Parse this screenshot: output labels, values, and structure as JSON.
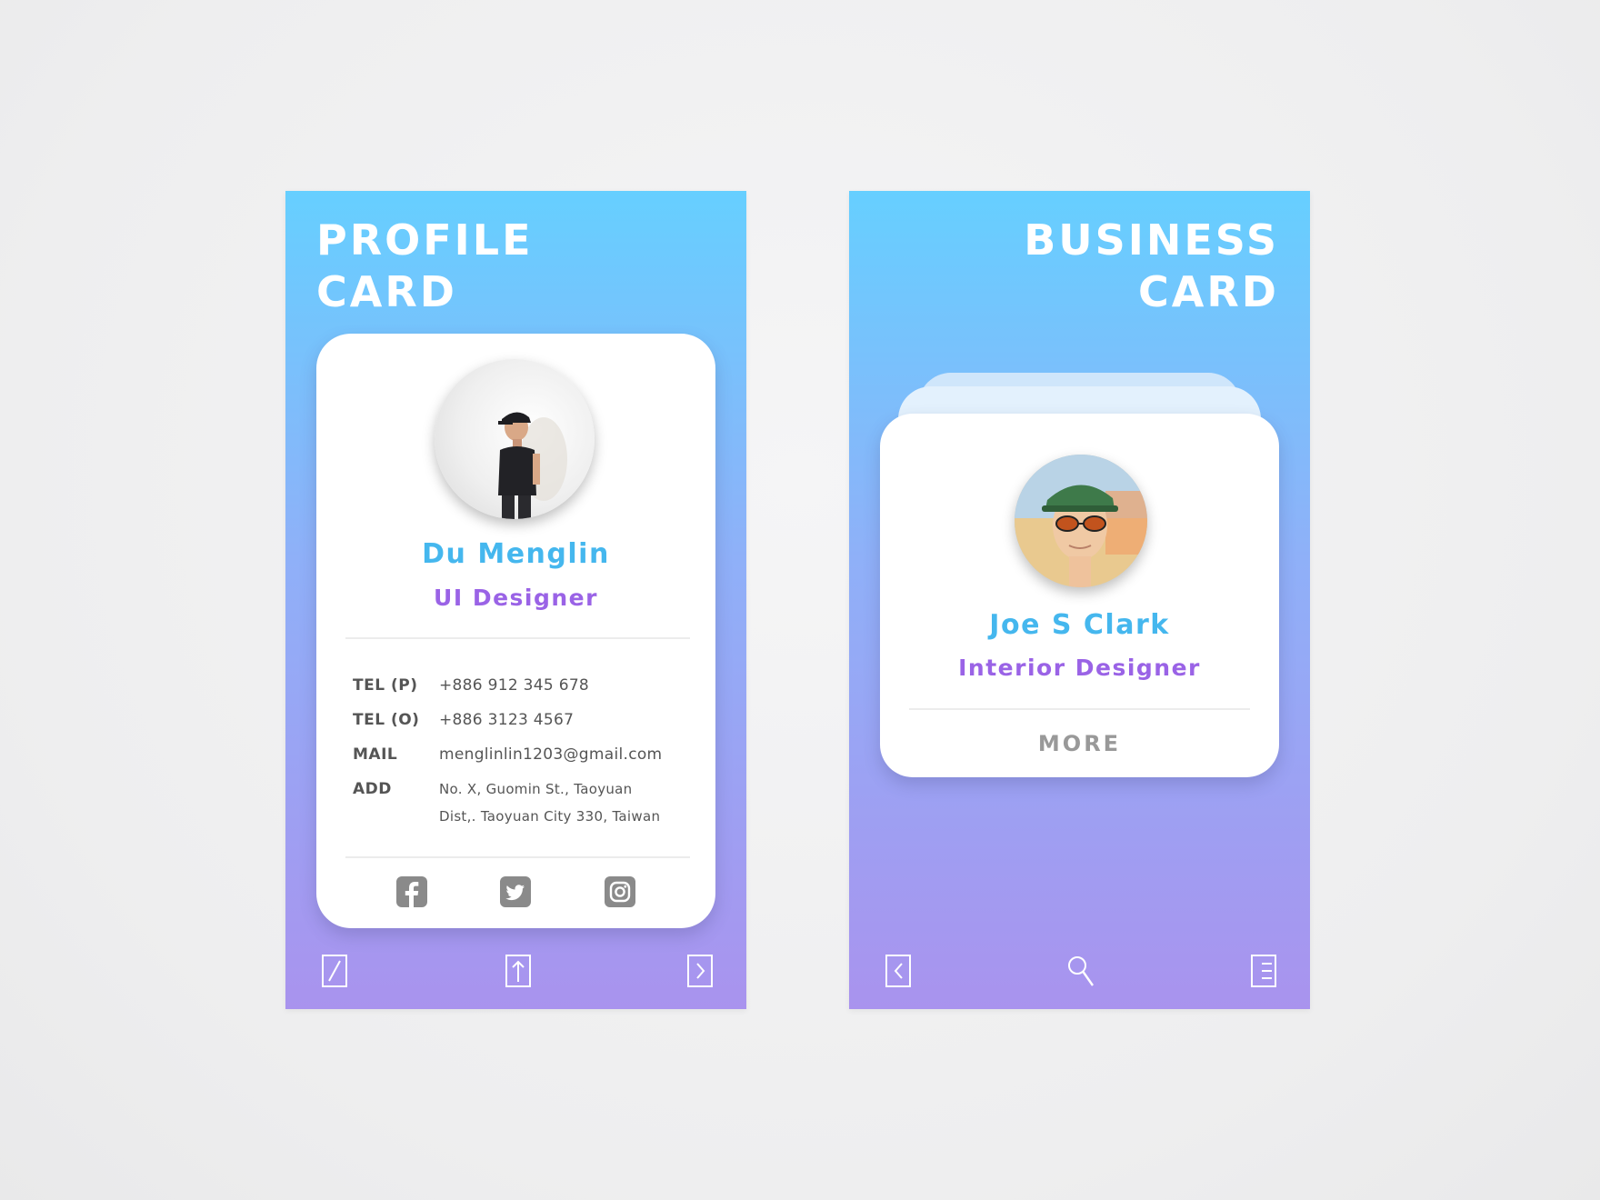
{
  "profile_panel": {
    "title_line1": "PROFILE",
    "title_line2": "CARD",
    "card": {
      "name": "Du Menglin",
      "role": "UI Designer",
      "info": [
        {
          "label": "TEL (P)",
          "value": "+886 912 345 678"
        },
        {
          "label": "TEL (O)",
          "value": "+886 3123 4567"
        },
        {
          "label": "MAIL",
          "value": "menglinlin1203@gmail.com"
        },
        {
          "label": "ADD",
          "value_line1": "No. X, Guomin St., Taoyuan",
          "value_line2": "Dist,. Taoyuan City 330, Taiwan"
        }
      ],
      "social_icons": [
        "facebook-icon",
        "twitter-icon",
        "instagram-icon"
      ]
    },
    "nav_icons": [
      "edit-icon",
      "share-icon",
      "next-icon"
    ]
  },
  "business_panel": {
    "title_line1": "BUSINESS",
    "title_line2": "CARD",
    "card": {
      "name": "Joe S Clark",
      "role": "Interior Designer",
      "more_label": "MORE"
    },
    "nav_icons": [
      "back-icon",
      "search-icon",
      "list-icon"
    ]
  },
  "colors": {
    "gradient_top": "#66cfff",
    "gradient_bottom": "#a993ee",
    "name_blue": "#45b7ee",
    "role_purple": "#9a63e6",
    "text_gray": "#555555",
    "icon_gray": "#8a8a8a"
  }
}
